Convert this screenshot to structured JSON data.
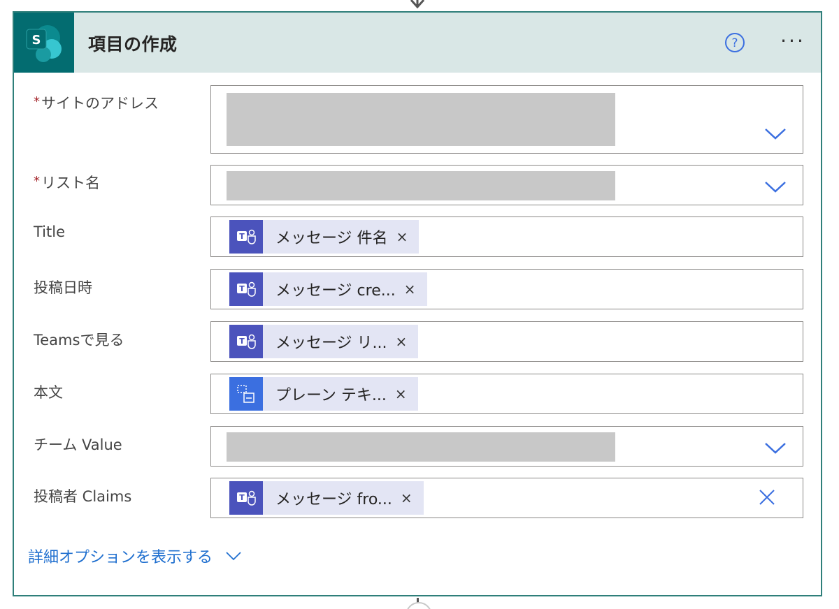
{
  "card": {
    "title": "項目の作成",
    "help_icon": "question-circle-icon",
    "more_label": "···"
  },
  "fields": {
    "site_address": {
      "label": "サイトのアドレス",
      "required_mark": "*"
    },
    "list_name": {
      "label": "リスト名",
      "required_mark": "*"
    },
    "title": {
      "label": "Title",
      "token": "メッセージ 件名",
      "close": "×"
    },
    "posted_at": {
      "label": "投稿日時",
      "token": "メッセージ cre...",
      "close": "×"
    },
    "teams_link": {
      "label": "Teamsで見る",
      "token": "メッセージ リ...",
      "close": "×"
    },
    "body": {
      "label": "本文",
      "token": "プレーン テキ...",
      "close": "×"
    },
    "team_value": {
      "label": "チーム Value"
    },
    "poster_claims": {
      "label": "投稿者 Claims",
      "token": "メッセージ fro...",
      "close": "×"
    }
  },
  "advanced_options": {
    "label": "詳細オプションを表示する"
  },
  "colors": {
    "header_bg": "#d9e7e6",
    "border": "#2f7f7a",
    "sharepoint": "#036c70",
    "teams": "#4b53bc",
    "link": "#1f6fcf"
  }
}
